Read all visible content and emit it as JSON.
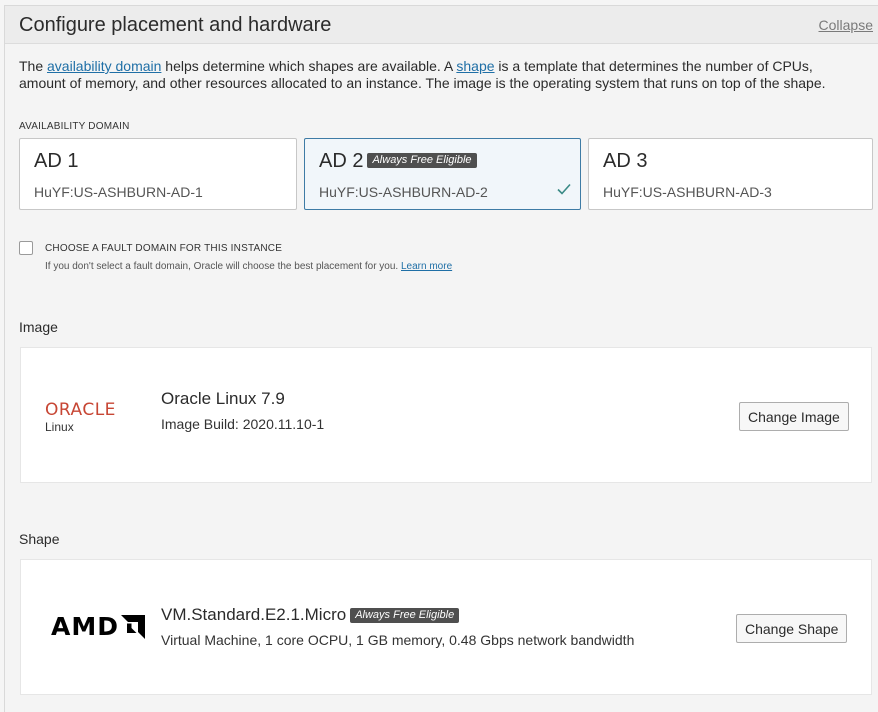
{
  "header": {
    "title": "Configure placement and hardware",
    "collapse_label": "Collapse"
  },
  "intro": {
    "p1": "The ",
    "link1": "availability domain",
    "p2": " helps determine which shapes are available. A ",
    "link2": "shape",
    "p3": " is a template that determines the number of CPUs, amount of memory, and other resources allocated to an instance. The image is the operating system that runs on top of the shape."
  },
  "availability_domain": {
    "label": "AVAILABILITY DOMAIN",
    "cards": [
      {
        "name": "AD 1",
        "id": "HuYF:US-ASHBURN-AD-1"
      },
      {
        "name": "AD 2",
        "badge": "Always Free Eligible",
        "id": "HuYF:US-ASHBURN-AD-2",
        "selected": true
      },
      {
        "name": "AD 3",
        "id": "HuYF:US-ASHBURN-AD-3"
      }
    ]
  },
  "fault_domain": {
    "label": "CHOOSE A FAULT DOMAIN FOR THIS INSTANCE",
    "checked": false,
    "help": "If you don't select a fault domain, Oracle will choose the best placement for you. ",
    "learn_more": "Learn more"
  },
  "image": {
    "section_title": "Image",
    "logo_text": "ORACLE",
    "logo_sub": "Linux",
    "name": "Oracle Linux 7.9",
    "build": "Image Build: 2020.11.10-1",
    "button": "Change Image"
  },
  "shape": {
    "section_title": "Shape",
    "logo_text": "AMD",
    "name": "VM.Standard.E2.1.Micro",
    "badge": "Always Free Eligible",
    "description": "Virtual Machine, 1 core OCPU, 1 GB memory, 0.48 Gbps network bandwidth",
    "button": "Change Shape"
  },
  "colors": {
    "link": "#1f6fa6",
    "selected_border": "#3e7ba5",
    "oracle_red": "#c74634",
    "check": "#3a8a86"
  },
  "icons": {
    "selected": "check-icon",
    "amd_arrow": "amd-arrow-icon"
  }
}
